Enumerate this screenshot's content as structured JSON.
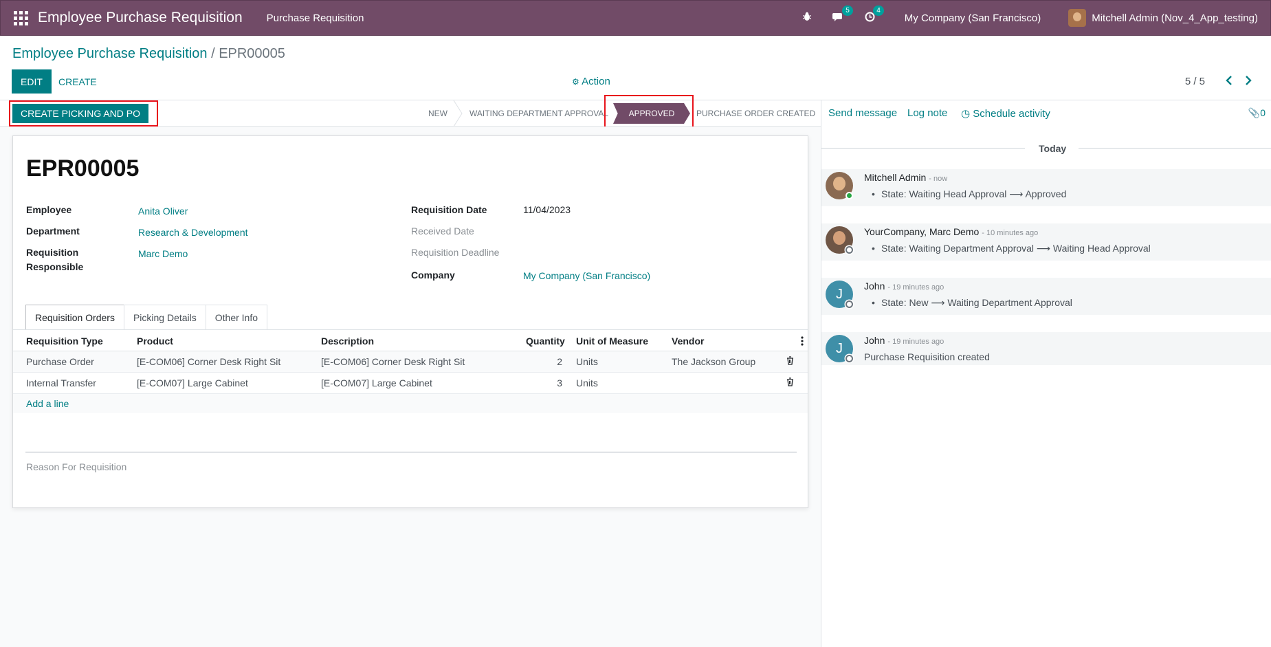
{
  "navbar": {
    "app_title": "Employee Purchase Requisition",
    "menu_item": "Purchase Requisition",
    "messages_count": "5",
    "activities_count": "4",
    "company": "My Company (San Francisco)",
    "user": "Mitchell Admin (Nov_4_App_testing)"
  },
  "breadcrumb": {
    "parent": "Employee Purchase Requisition",
    "separator": "/",
    "current": "EPR00005"
  },
  "toolbar": {
    "edit_label": "EDIT",
    "create_label": "CREATE",
    "action_label": "Action",
    "pager": "5 / 5"
  },
  "statusbar": {
    "button_label": "CREATE PICKING AND PO",
    "stages": [
      "NEW",
      "WAITING DEPARTMENT APPROVAL",
      "APPROVED",
      "PURCHASE ORDER CREATED"
    ],
    "active_stage": "APPROVED"
  },
  "form": {
    "title": "EPR00005",
    "fields": {
      "employee_label": "Employee",
      "employee_value": "Anita Oliver",
      "department_label": "Department",
      "department_value": "Research & Development",
      "responsible_label_1": "Requisition",
      "responsible_label_2": "Responsible",
      "responsible_value": "Marc Demo",
      "req_date_label": "Requisition Date",
      "req_date_value": "11/04/2023",
      "received_date_label": "Received Date",
      "deadline_label": "Requisition Deadline",
      "company_label": "Company",
      "company_value": "My Company (San Francisco)"
    },
    "tabs": [
      "Requisition Orders",
      "Picking Details",
      "Other Info"
    ],
    "table": {
      "columns": [
        "Requisition Type",
        "Product",
        "Description",
        "Quantity",
        "Unit of Measure",
        "Vendor"
      ],
      "rows": [
        {
          "type": "Purchase Order",
          "product": "[E-COM06] Corner Desk Right Sit",
          "description": "[E-COM06] Corner Desk Right Sit",
          "quantity": "2",
          "uom": "Units",
          "vendor": "The Jackson Group"
        },
        {
          "type": "Internal Transfer",
          "product": "[E-COM07] Large Cabinet",
          "description": "[E-COM07] Large Cabinet",
          "quantity": "3",
          "uom": "Units",
          "vendor": ""
        }
      ],
      "add_line": "Add a line"
    },
    "reason_placeholder": "Reason For Requisition"
  },
  "chatter": {
    "send_message": "Send message",
    "log_note": "Log note",
    "schedule_activity": "Schedule activity",
    "attachments": "0",
    "date_separator": "Today",
    "messages": [
      {
        "author": "Mitchell Admin",
        "time": "- now",
        "body": "State: Waiting Head Approval ⟶ Approved"
      },
      {
        "author": "YourCompany, Marc Demo",
        "time": "- 10 minutes ago",
        "body": "State: Waiting Department Approval ⟶ Waiting Head Approval"
      },
      {
        "author": "John",
        "time": "- 19 minutes ago",
        "body": "State: New ⟶ Waiting Department Approval",
        "initial": "J"
      },
      {
        "author": "John",
        "time": "- 19 minutes ago",
        "body": "Purchase Requisition created",
        "initial": "J"
      }
    ]
  },
  "colors": {
    "brand": "#714b67",
    "accent": "#017e84",
    "highlight": "#e8131b"
  }
}
